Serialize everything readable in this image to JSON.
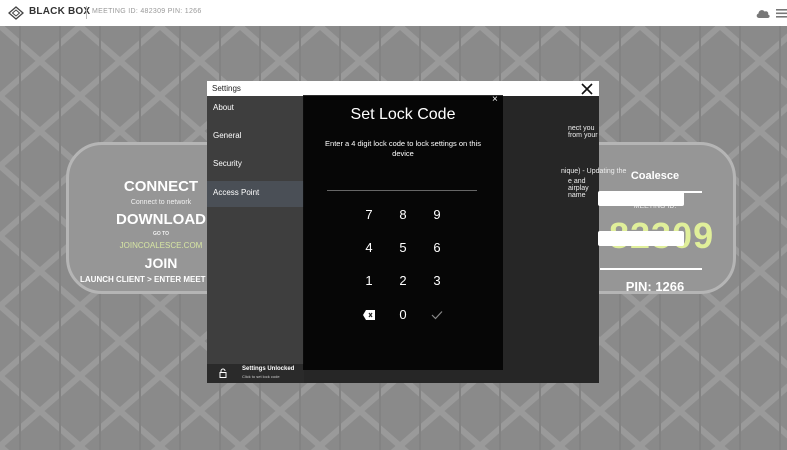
{
  "topbar": {
    "brand": "BLACK BOX",
    "meeting_text": "MEETING ID: 482309   PIN: 1266"
  },
  "left_card": {
    "connect": "CONNECT",
    "connect_sub": "Connect to network",
    "download": "DOWNLOAD",
    "goto": "GO TO",
    "url": "JOINCOALESCE.COM",
    "join": "JOIN",
    "launch": "LAUNCH CLIENT > ENTER MEET"
  },
  "right_card": {
    "name": "Coalesce",
    "meeting_label": "MEETING ID:",
    "meeting_id": "·82309",
    "pin": "PIN: 1266"
  },
  "settings": {
    "title": "Settings",
    "sidebar": [
      {
        "label": "About",
        "active": false
      },
      {
        "label": "General",
        "active": false
      },
      {
        "label": "Security",
        "active": false
      },
      {
        "label": "Access Point",
        "active": true
      }
    ],
    "unlock_title": "Settings Unlocked",
    "unlock_sub": "Click to set lock code",
    "access_point": {
      "text1": "nect you from your",
      "text2": "nique) - Updating the",
      "text3": "e and airplay name"
    }
  },
  "lock_dialog": {
    "close": "×",
    "title": "Set Lock Code",
    "description": "Enter a 4 digit lock code to lock settings on this device",
    "keys": [
      "7",
      "8",
      "9",
      "4",
      "5",
      "6",
      "1",
      "2",
      "3",
      "0"
    ]
  },
  "colors": {
    "accent_green": "#e0ef9a",
    "url_green": "#d7e6a3",
    "stage_gray": "#8a8a8a"
  }
}
